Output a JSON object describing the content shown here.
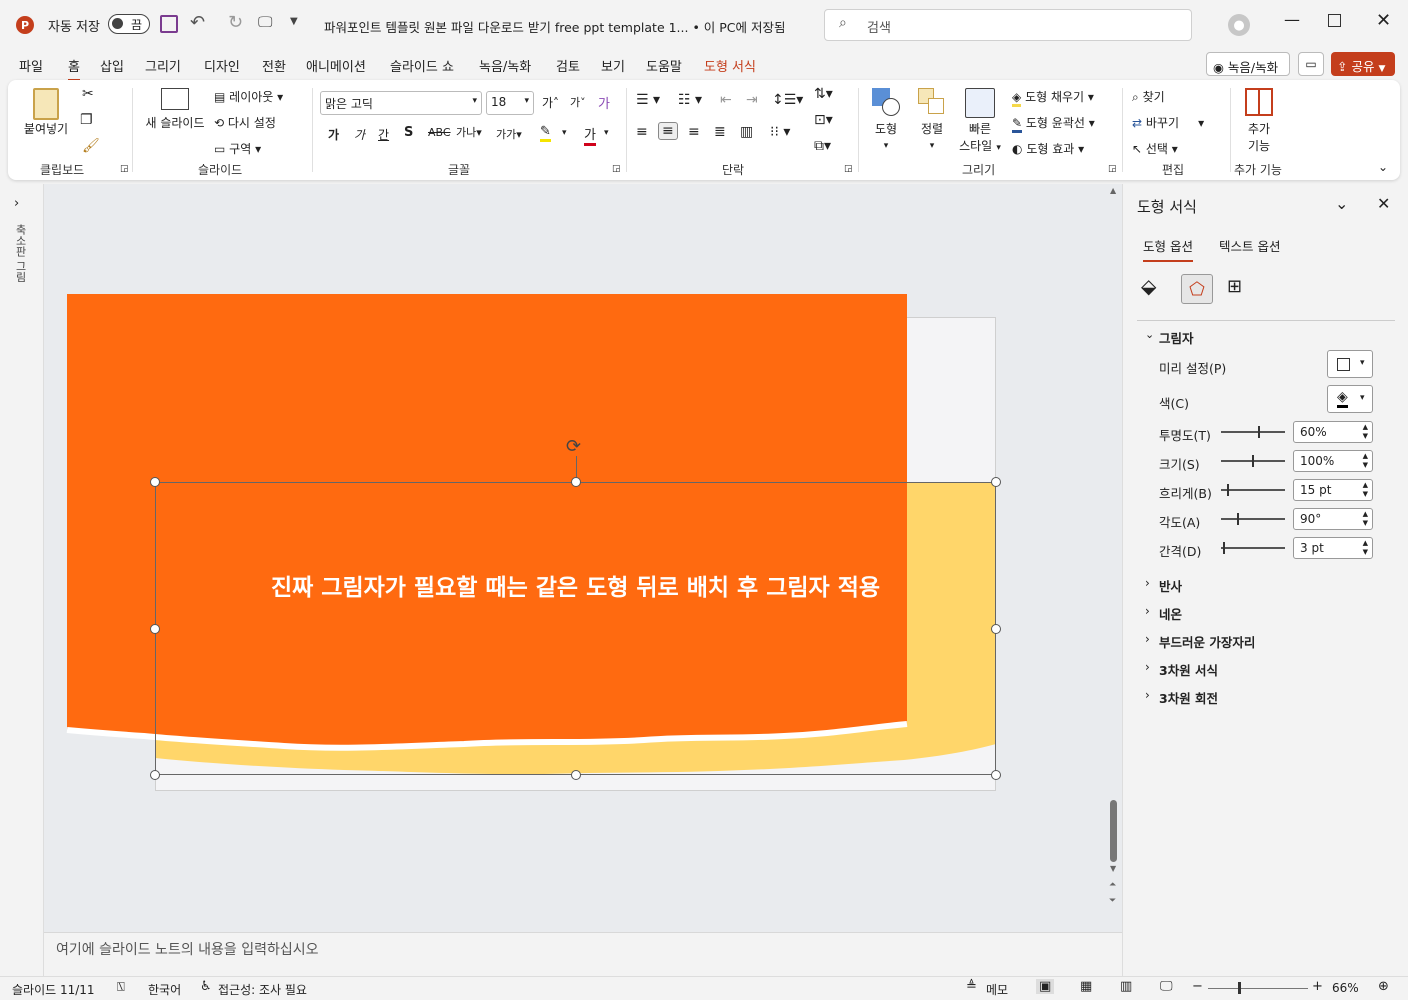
{
  "titlebar": {
    "autosave_label": "자동 저장",
    "autosave_state": "끔",
    "doc_title": "파워포인트 템플릿 원본 파일 다운로드 받기 free ppt template 1... • 이 PC에 저장됨",
    "search_placeholder": "검색"
  },
  "menu": {
    "tabs": [
      "파일",
      "홈",
      "삽입",
      "그리기",
      "디자인",
      "전환",
      "애니메이션",
      "슬라이드 쇼",
      "녹음/녹화",
      "검토",
      "보기",
      "도움말",
      "도형 서식"
    ],
    "record_button": "녹음/녹화",
    "share_button": "공유"
  },
  "ribbon": {
    "paste": "붙여넣기",
    "clipboard": "클립보드",
    "new_slide": "새 슬라이드",
    "layout": "레이아웃",
    "reset": "다시 설정",
    "section": "구역",
    "slides": "슬라이드",
    "font_name": "맑은 고딕",
    "font_size": "18",
    "font_group": "글꼴",
    "paragraph": "단락",
    "shape": "도형",
    "arrange": "정렬",
    "quick_style_1": "빠른",
    "quick_style_2": "스타일",
    "shape_fill": "도형 채우기",
    "shape_outline": "도형 윤곽선",
    "shape_effect": "도형 효과",
    "drawing": "그리기",
    "find": "찾기",
    "replace": "바꾸기",
    "select": "선택",
    "editing": "편집",
    "addins_1": "추가",
    "addins_2": "기능",
    "addins_group": "추가 기능"
  },
  "leftstrip": {
    "thumbnails_label": "축소판 그림"
  },
  "slide": {
    "text": "진짜 그림자가 필요할 때는 같은 도형 뒤로 배치 후 그림자 적용",
    "orange": "#ff6a10",
    "yellow": "#ffd66a"
  },
  "notes": {
    "placeholder": "여기에 슬라이드 노트의 내용을 입력하십시오"
  },
  "pane": {
    "title": "도형 서식",
    "tab_shape": "도형 옵션",
    "tab_text": "텍스트 옵션",
    "shadow_section": "그림자",
    "preset_label": "미리 설정(P)",
    "color_label": "색(C)",
    "rows": [
      {
        "label": "투명도(T)",
        "value": "60%",
        "level": 0.6
      },
      {
        "label": "크기(S)",
        "value": "100%",
        "level": 0.5
      },
      {
        "label": "흐리게(B)",
        "value": "15 pt",
        "level": 0.1
      },
      {
        "label": "각도(A)",
        "value": "90°",
        "level": 0.25
      },
      {
        "label": "간격(D)",
        "value": "3 pt",
        "level": 0.03
      }
    ],
    "sections": [
      "반사",
      "네온",
      "부드러운 가장자리",
      "3차원 서식",
      "3차원 회전"
    ]
  },
  "status": {
    "slide": "슬라이드 11/11",
    "language": "한국어",
    "accessibility": "접근성: 조사 필요",
    "notes": "메모",
    "zoom": "66%"
  }
}
